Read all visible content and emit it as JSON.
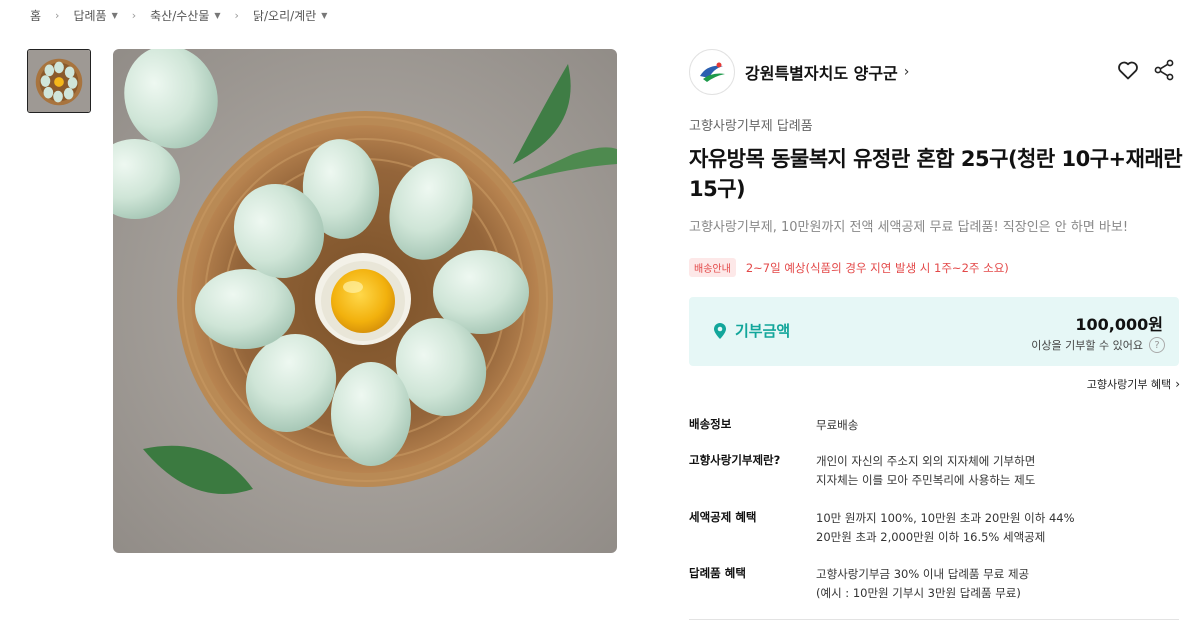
{
  "breadcrumb": [
    {
      "label": "홈",
      "dropdown": false
    },
    {
      "label": "답례품",
      "dropdown": true
    },
    {
      "label": "축산/수산물",
      "dropdown": true
    },
    {
      "label": "닭/오리/계란",
      "dropdown": true
    }
  ],
  "seller": {
    "name": "강원특별자치도 양구군"
  },
  "product": {
    "category": "고향사랑기부제 답례품",
    "title": "자유방목 동물복지 유정란 혼합 25구(청란 10구+재래란 15구)",
    "subtitle": "고향사랑기부제, 10만원까지 전액 세액공제 무료 답례품! 직장인은 안 하면 바보!"
  },
  "shipping_notice": {
    "badge": "배송안내",
    "text": "2~7일 예상(식품의 경우 지연 발생 시 1주~2주 소요)"
  },
  "donation": {
    "label": "기부금액",
    "amount": "100,000원",
    "note": "이상을 기부할 수 있어요",
    "help": "?"
  },
  "benefit_link": "고향사랑기부 혜택",
  "info": {
    "shipping_label": "배송정보",
    "shipping_value": "무료배송",
    "what_label": "고향사랑기부제란?",
    "what_line1": "개인이 자신의 주소지 외의 지자체에 기부하면",
    "what_line2": "지자체는 이를 모아 주민복리에 사용하는 제도",
    "tax_label": "세액공제 혜택",
    "tax_line1": "10만 원까지 100%, 10만원 초과 20만원 이하 44%",
    "tax_line2": "20만원 초과 2,000만원 이하 16.5% 세액공제",
    "gift_label": "답례품 혜택",
    "gift_line1": "고향사랑기부금 30% 이내 답례품 무료 제공",
    "gift_line2": "(예시 : 10만원 기부시 3만원 답례품 무료)"
  },
  "icons": {
    "heart": "heart-icon",
    "share": "share-icon",
    "pin": "location-pin-icon",
    "chevron": "chevron-right-icon"
  },
  "colors": {
    "accent": "#13a69b",
    "donation_bg": "#e6f7f6",
    "notice_red": "#e34848"
  }
}
